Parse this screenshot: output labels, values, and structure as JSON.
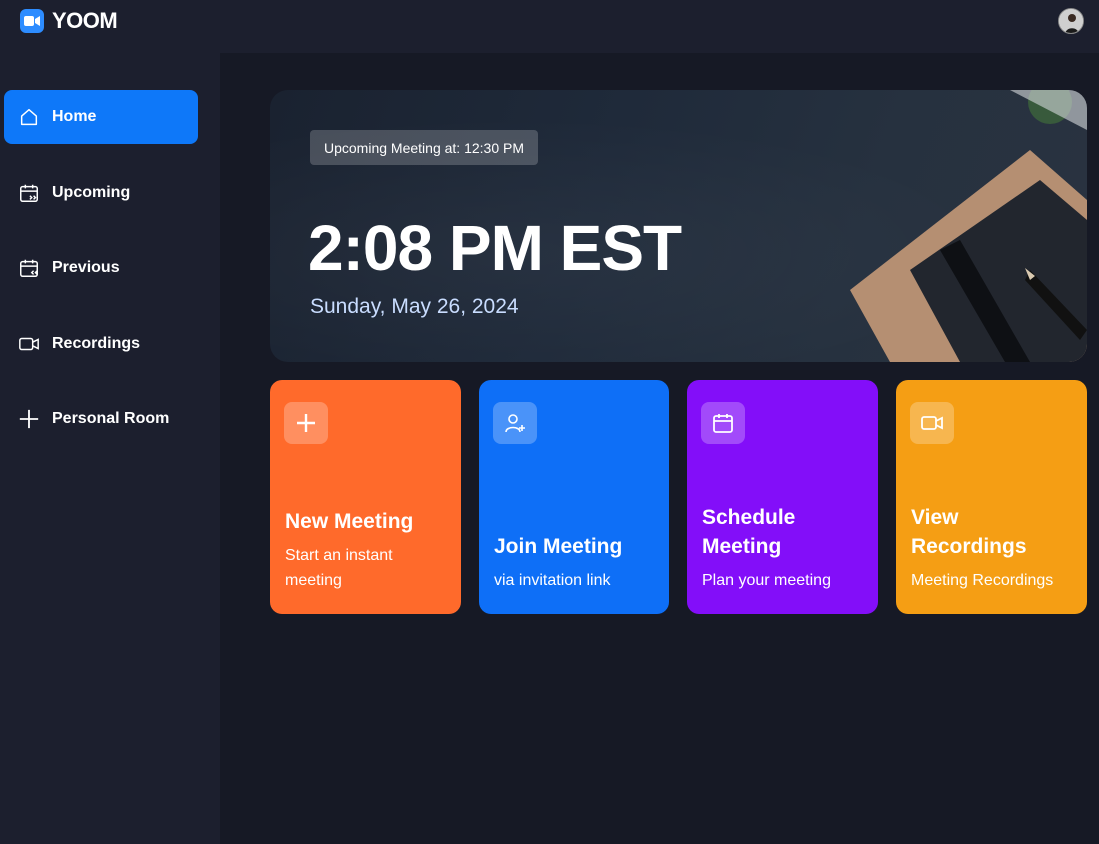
{
  "app": {
    "name": "YOOM"
  },
  "sidebar": {
    "items": [
      {
        "label": "Home",
        "icon": "home-icon",
        "active": true
      },
      {
        "label": "Upcoming",
        "icon": "calendar-upcoming-icon"
      },
      {
        "label": "Previous",
        "icon": "calendar-previous-icon"
      },
      {
        "label": "Recordings",
        "icon": "video-icon"
      },
      {
        "label": "Personal Room",
        "icon": "plus-icon"
      }
    ]
  },
  "hero": {
    "badge": "Upcoming Meeting at: 12:30 PM",
    "time": "2:08 PM EST",
    "date": "Sunday, May 26, 2024"
  },
  "cards": [
    {
      "title_line1": "New Meeting",
      "title_line2": "",
      "subtitle_line1": "Start an instant",
      "subtitle_line2": "meeting",
      "color": "#ff6a2b",
      "icon": "plus-icon"
    },
    {
      "title_line1": "Join Meeting",
      "title_line2": "",
      "subtitle_line1": "via invitation link",
      "subtitle_line2": "",
      "color": "#0e6ff7",
      "icon": "add-user-icon"
    },
    {
      "title_line1": "Schedule",
      "title_line2": "Meeting",
      "subtitle_line1": "Plan your meeting",
      "subtitle_line2": "",
      "color": "#830ef9",
      "icon": "calendar-icon"
    },
    {
      "title_line1": "View",
      "title_line2": "Recordings",
      "subtitle_line1": "Meeting Recordings",
      "subtitle_line2": "",
      "color": "#f59e14",
      "icon": "video-icon"
    }
  ],
  "colors": {
    "background": "#161925",
    "panel": "#1c1f2e",
    "accent": "#0e78f9"
  }
}
